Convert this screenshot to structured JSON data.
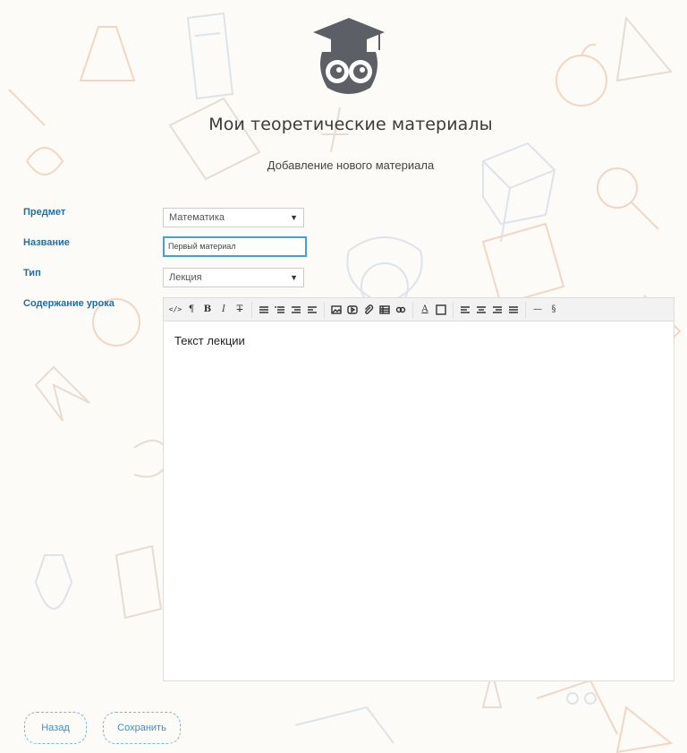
{
  "header": {
    "title": "Мои теоретические материалы",
    "subtitle": "Добавление нового материала"
  },
  "form": {
    "subject": {
      "label": "Предмет",
      "value": "Математика"
    },
    "name": {
      "label": "Название",
      "value": "Первый материал"
    },
    "type": {
      "label": "Тип",
      "value": "Лекция"
    },
    "content": {
      "label": "Содержание урока",
      "text": "Текст лекции"
    }
  },
  "toolbar": {
    "buttons": [
      "html",
      "paragraph",
      "bold",
      "italic",
      "strikethrough",
      "unordered-list",
      "ordered-list",
      "outdent",
      "indent",
      "image",
      "video",
      "file",
      "table",
      "link",
      "font-color",
      "back-color",
      "align-left",
      "align-center",
      "align-right",
      "justify",
      "horizontal-rule",
      "section"
    ]
  },
  "actions": {
    "back_label": "Назад",
    "save_label": "Сохранить"
  },
  "colors": {
    "label": "#1d6fa5",
    "button_text": "#3a8fc5",
    "input_focus": "#4a9fc9",
    "logo": "#5c6066"
  }
}
